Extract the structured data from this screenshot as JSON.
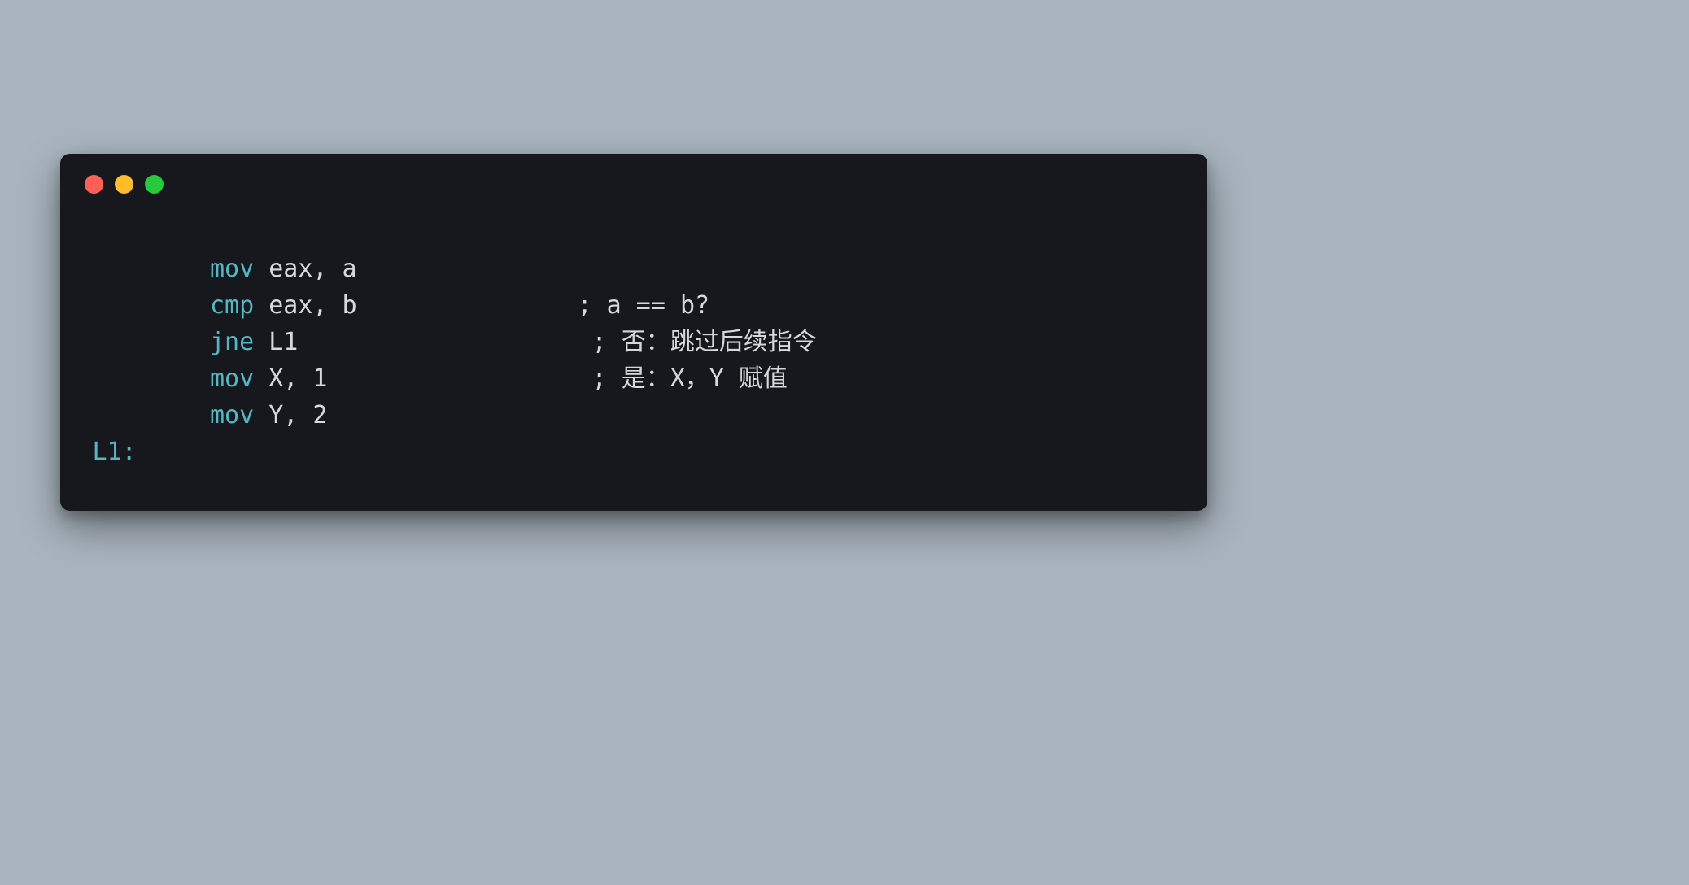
{
  "window": {
    "traffic_lights": [
      "close",
      "minimize",
      "maximize"
    ]
  },
  "code": {
    "indent": "        ",
    "lines": [
      {
        "label": "",
        "kw": "mov",
        "operands": " eax, a",
        "comment": ""
      },
      {
        "label": "",
        "kw": "cmp",
        "operands": " eax, b",
        "comment": "               ; a == b?"
      },
      {
        "label": "",
        "kw": "jne",
        "operands": " L1",
        "comment": "                    ; 否：跳过后续指令"
      },
      {
        "label": "",
        "kw": "mov",
        "operands": " X, 1",
        "comment": "                  ; 是：X，Y 赋值"
      },
      {
        "label": "",
        "kw": "mov",
        "operands": " Y, 2",
        "comment": ""
      },
      {
        "label": "L1:",
        "kw": "",
        "operands": "",
        "comment": ""
      }
    ]
  },
  "colors": {
    "background": "#a9b4be",
    "window_bg": "#16181d",
    "keyword": "#56b6c2",
    "text": "#d6d9dc"
  }
}
